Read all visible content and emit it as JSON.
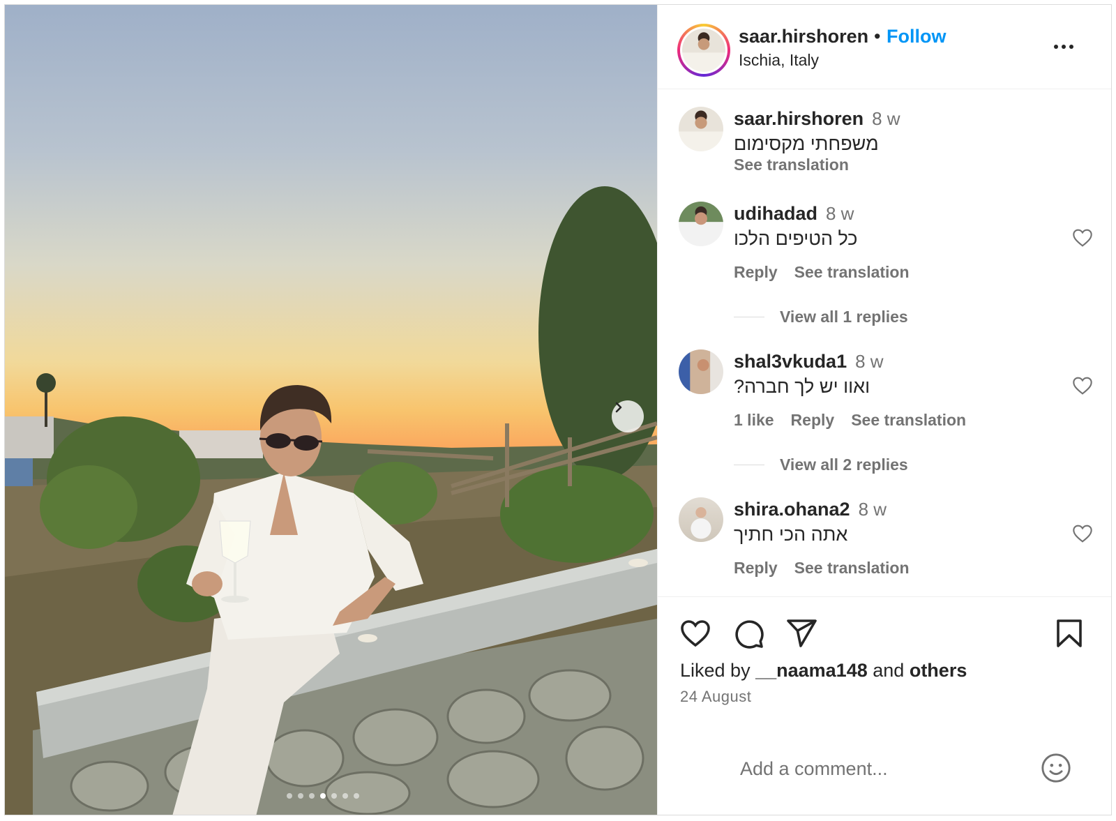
{
  "post": {
    "author": "saar.hirshoren",
    "separator": "•",
    "follow_label": "Follow",
    "location": "Ischia, Italy",
    "more_icon": "more-horizontal-icon",
    "carousel": {
      "total_slides": 7,
      "active_slide": 4
    }
  },
  "caption": {
    "user": "saar.hirshoren",
    "time": "8 w",
    "text": "משפחתי מקסימום",
    "see_translation": "See translation"
  },
  "comments": [
    {
      "user": "udihadad",
      "time": "8 w",
      "text": "כל הטיפים הלכו",
      "likes": "",
      "reply": "Reply",
      "see_translation": "See translation",
      "view_replies": "View all 1 replies"
    },
    {
      "user": "shal3vkuda1",
      "time": "8 w",
      "text": "ואוו יש לך חברה?",
      "likes": "1 like",
      "reply": "Reply",
      "see_translation": "See translation",
      "view_replies": "View all 2 replies"
    },
    {
      "user": "shira.ohana2",
      "time": "8 w",
      "text": "אתה הכי חתיך",
      "likes": "",
      "reply": "Reply",
      "see_translation": "See translation",
      "view_replies": ""
    }
  ],
  "footer": {
    "liked_prefix": "Liked by",
    "liked_user": "__naama148",
    "liked_and": "and",
    "liked_others": "others",
    "date": "24 August",
    "comment_placeholder": "Add a comment..."
  },
  "colors": {
    "link": "#0095f6",
    "secondary_text": "#737373",
    "primary_text": "#262626",
    "divider": "#efefef"
  }
}
